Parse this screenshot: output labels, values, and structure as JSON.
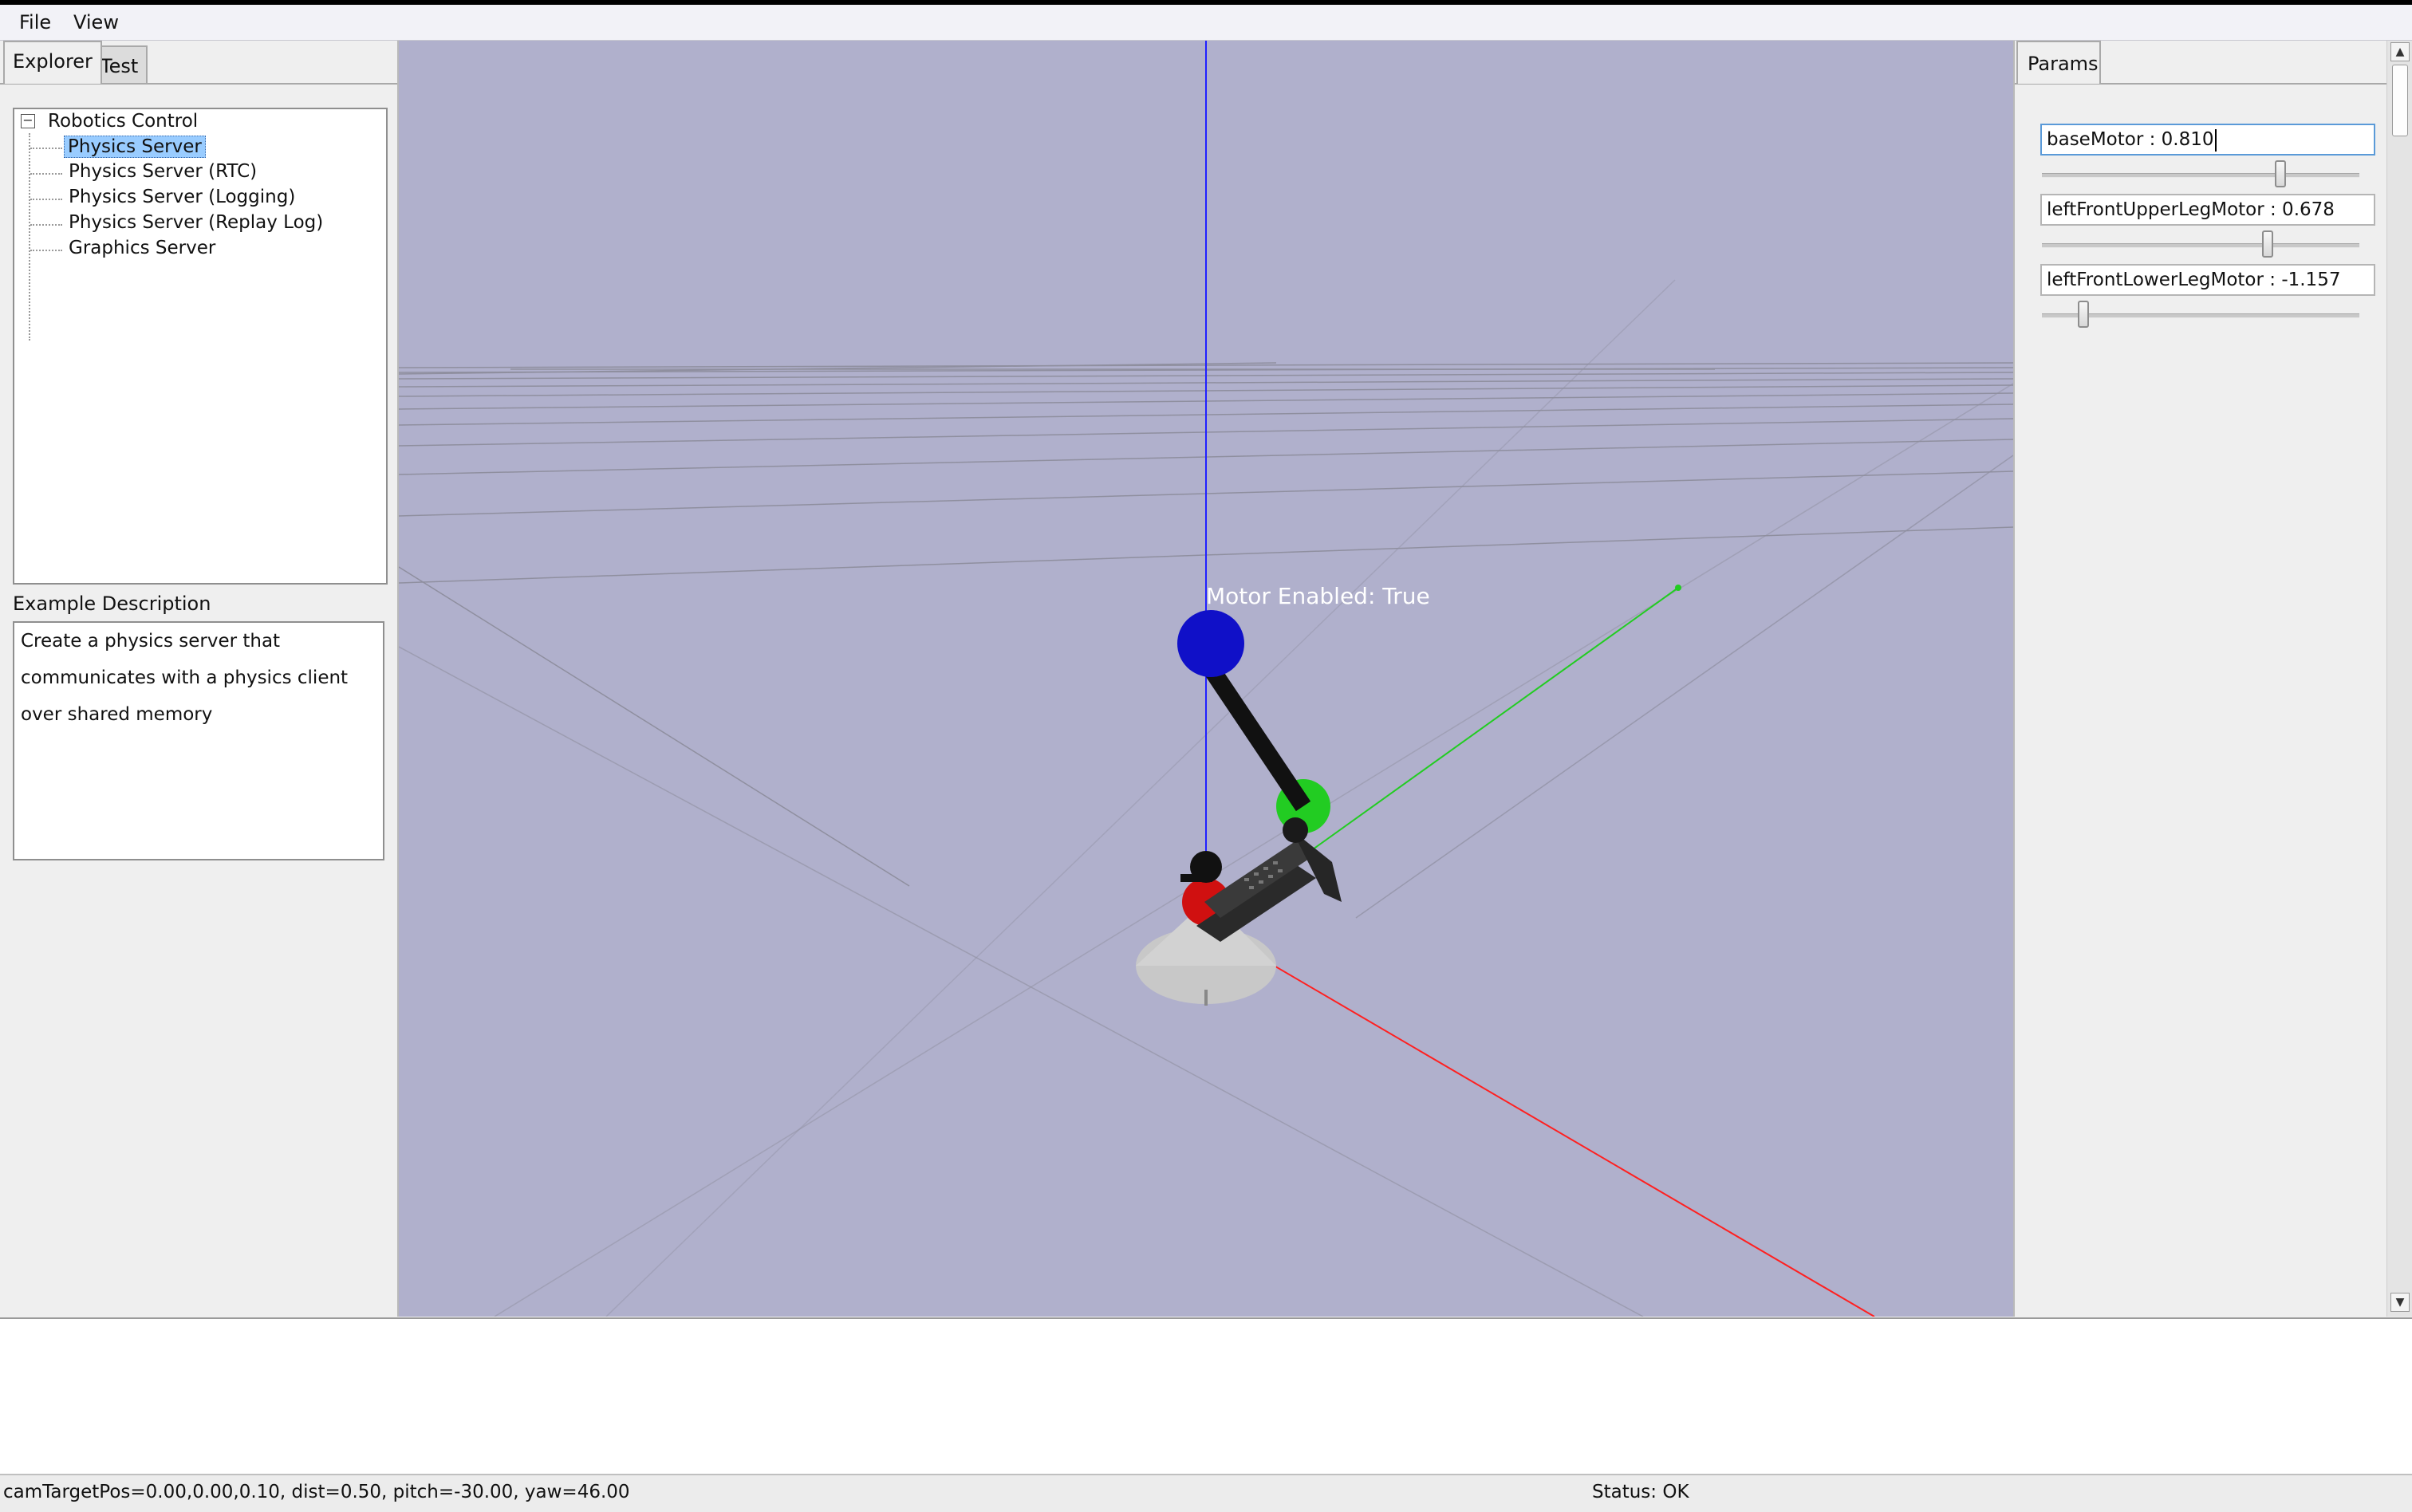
{
  "menu": {
    "file": "File",
    "view": "View"
  },
  "left_panel": {
    "tabs": {
      "explorer": "Explorer",
      "test": "Test"
    },
    "tree": {
      "root": "Robotics Control",
      "items": [
        "Physics Server",
        "Physics Server (RTC)",
        "Physics Server (Logging)",
        "Physics Server (Replay Log)",
        "Graphics Server"
      ],
      "selected_index": 0
    },
    "description_label": "Example Description",
    "description_lines": [
      "Create a physics server that",
      "communicates with a physics client",
      "over shared memory"
    ]
  },
  "viewport": {
    "overlay_text": "Motor Enabled: True",
    "background_color": "#b0b0cc",
    "axis_colors": {
      "x": "#ff2020",
      "y": "#22cc22",
      "z": "#2020ff"
    }
  },
  "params_panel": {
    "tab_label": "Params",
    "params": [
      {
        "text": "baseMotor : 0.810",
        "slider_fraction": 0.75,
        "focused": true
      },
      {
        "text": "leftFrontUpperLegMotor : 0.678",
        "slider_fraction": 0.71,
        "focused": false
      },
      {
        "text": "leftFrontLowerLegMotor : -1.157",
        "slider_fraction": 0.13,
        "focused": false
      }
    ]
  },
  "status_bar": {
    "camera_info": "camTargetPos=0.00,0.00,0.10, dist=0.50, pitch=-30.00, yaw=46.00",
    "status": "Status: OK"
  }
}
